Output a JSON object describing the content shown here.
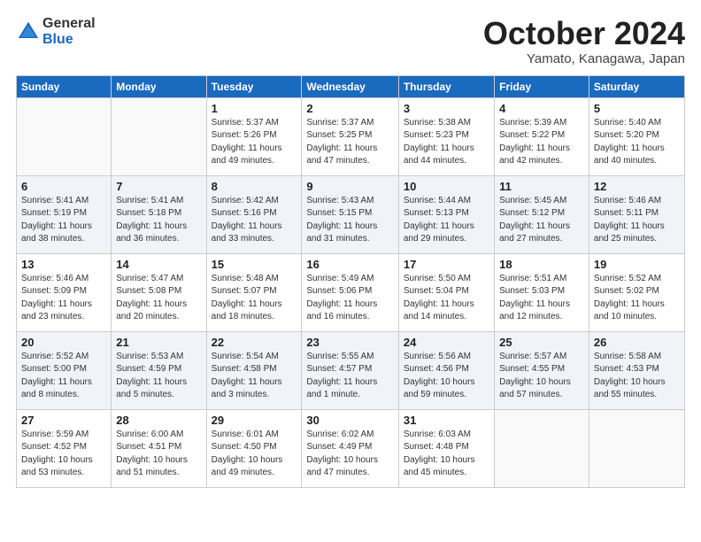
{
  "logo": {
    "general": "General",
    "blue": "Blue"
  },
  "title": "October 2024",
  "location": "Yamato, Kanagawa, Japan",
  "days_of_week": [
    "Sunday",
    "Monday",
    "Tuesday",
    "Wednesday",
    "Thursday",
    "Friday",
    "Saturday"
  ],
  "weeks": [
    [
      {
        "day": "",
        "info": ""
      },
      {
        "day": "",
        "info": ""
      },
      {
        "day": "1",
        "info": "Sunrise: 5:37 AM\nSunset: 5:26 PM\nDaylight: 11 hours and 49 minutes."
      },
      {
        "day": "2",
        "info": "Sunrise: 5:37 AM\nSunset: 5:25 PM\nDaylight: 11 hours and 47 minutes."
      },
      {
        "day": "3",
        "info": "Sunrise: 5:38 AM\nSunset: 5:23 PM\nDaylight: 11 hours and 44 minutes."
      },
      {
        "day": "4",
        "info": "Sunrise: 5:39 AM\nSunset: 5:22 PM\nDaylight: 11 hours and 42 minutes."
      },
      {
        "day": "5",
        "info": "Sunrise: 5:40 AM\nSunset: 5:20 PM\nDaylight: 11 hours and 40 minutes."
      }
    ],
    [
      {
        "day": "6",
        "info": "Sunrise: 5:41 AM\nSunset: 5:19 PM\nDaylight: 11 hours and 38 minutes."
      },
      {
        "day": "7",
        "info": "Sunrise: 5:41 AM\nSunset: 5:18 PM\nDaylight: 11 hours and 36 minutes."
      },
      {
        "day": "8",
        "info": "Sunrise: 5:42 AM\nSunset: 5:16 PM\nDaylight: 11 hours and 33 minutes."
      },
      {
        "day": "9",
        "info": "Sunrise: 5:43 AM\nSunset: 5:15 PM\nDaylight: 11 hours and 31 minutes."
      },
      {
        "day": "10",
        "info": "Sunrise: 5:44 AM\nSunset: 5:13 PM\nDaylight: 11 hours and 29 minutes."
      },
      {
        "day": "11",
        "info": "Sunrise: 5:45 AM\nSunset: 5:12 PM\nDaylight: 11 hours and 27 minutes."
      },
      {
        "day": "12",
        "info": "Sunrise: 5:46 AM\nSunset: 5:11 PM\nDaylight: 11 hours and 25 minutes."
      }
    ],
    [
      {
        "day": "13",
        "info": "Sunrise: 5:46 AM\nSunset: 5:09 PM\nDaylight: 11 hours and 23 minutes."
      },
      {
        "day": "14",
        "info": "Sunrise: 5:47 AM\nSunset: 5:08 PM\nDaylight: 11 hours and 20 minutes."
      },
      {
        "day": "15",
        "info": "Sunrise: 5:48 AM\nSunset: 5:07 PM\nDaylight: 11 hours and 18 minutes."
      },
      {
        "day": "16",
        "info": "Sunrise: 5:49 AM\nSunset: 5:06 PM\nDaylight: 11 hours and 16 minutes."
      },
      {
        "day": "17",
        "info": "Sunrise: 5:50 AM\nSunset: 5:04 PM\nDaylight: 11 hours and 14 minutes."
      },
      {
        "day": "18",
        "info": "Sunrise: 5:51 AM\nSunset: 5:03 PM\nDaylight: 11 hours and 12 minutes."
      },
      {
        "day": "19",
        "info": "Sunrise: 5:52 AM\nSunset: 5:02 PM\nDaylight: 11 hours and 10 minutes."
      }
    ],
    [
      {
        "day": "20",
        "info": "Sunrise: 5:52 AM\nSunset: 5:00 PM\nDaylight: 11 hours and 8 minutes."
      },
      {
        "day": "21",
        "info": "Sunrise: 5:53 AM\nSunset: 4:59 PM\nDaylight: 11 hours and 5 minutes."
      },
      {
        "day": "22",
        "info": "Sunrise: 5:54 AM\nSunset: 4:58 PM\nDaylight: 11 hours and 3 minutes."
      },
      {
        "day": "23",
        "info": "Sunrise: 5:55 AM\nSunset: 4:57 PM\nDaylight: 11 hours and 1 minute."
      },
      {
        "day": "24",
        "info": "Sunrise: 5:56 AM\nSunset: 4:56 PM\nDaylight: 10 hours and 59 minutes."
      },
      {
        "day": "25",
        "info": "Sunrise: 5:57 AM\nSunset: 4:55 PM\nDaylight: 10 hours and 57 minutes."
      },
      {
        "day": "26",
        "info": "Sunrise: 5:58 AM\nSunset: 4:53 PM\nDaylight: 10 hours and 55 minutes."
      }
    ],
    [
      {
        "day": "27",
        "info": "Sunrise: 5:59 AM\nSunset: 4:52 PM\nDaylight: 10 hours and 53 minutes."
      },
      {
        "day": "28",
        "info": "Sunrise: 6:00 AM\nSunset: 4:51 PM\nDaylight: 10 hours and 51 minutes."
      },
      {
        "day": "29",
        "info": "Sunrise: 6:01 AM\nSunset: 4:50 PM\nDaylight: 10 hours and 49 minutes."
      },
      {
        "day": "30",
        "info": "Sunrise: 6:02 AM\nSunset: 4:49 PM\nDaylight: 10 hours and 47 minutes."
      },
      {
        "day": "31",
        "info": "Sunrise: 6:03 AM\nSunset: 4:48 PM\nDaylight: 10 hours and 45 minutes."
      },
      {
        "day": "",
        "info": ""
      },
      {
        "day": "",
        "info": ""
      }
    ]
  ],
  "row_styles": [
    "row-white",
    "row-stripe",
    "row-white",
    "row-stripe",
    "row-white"
  ]
}
